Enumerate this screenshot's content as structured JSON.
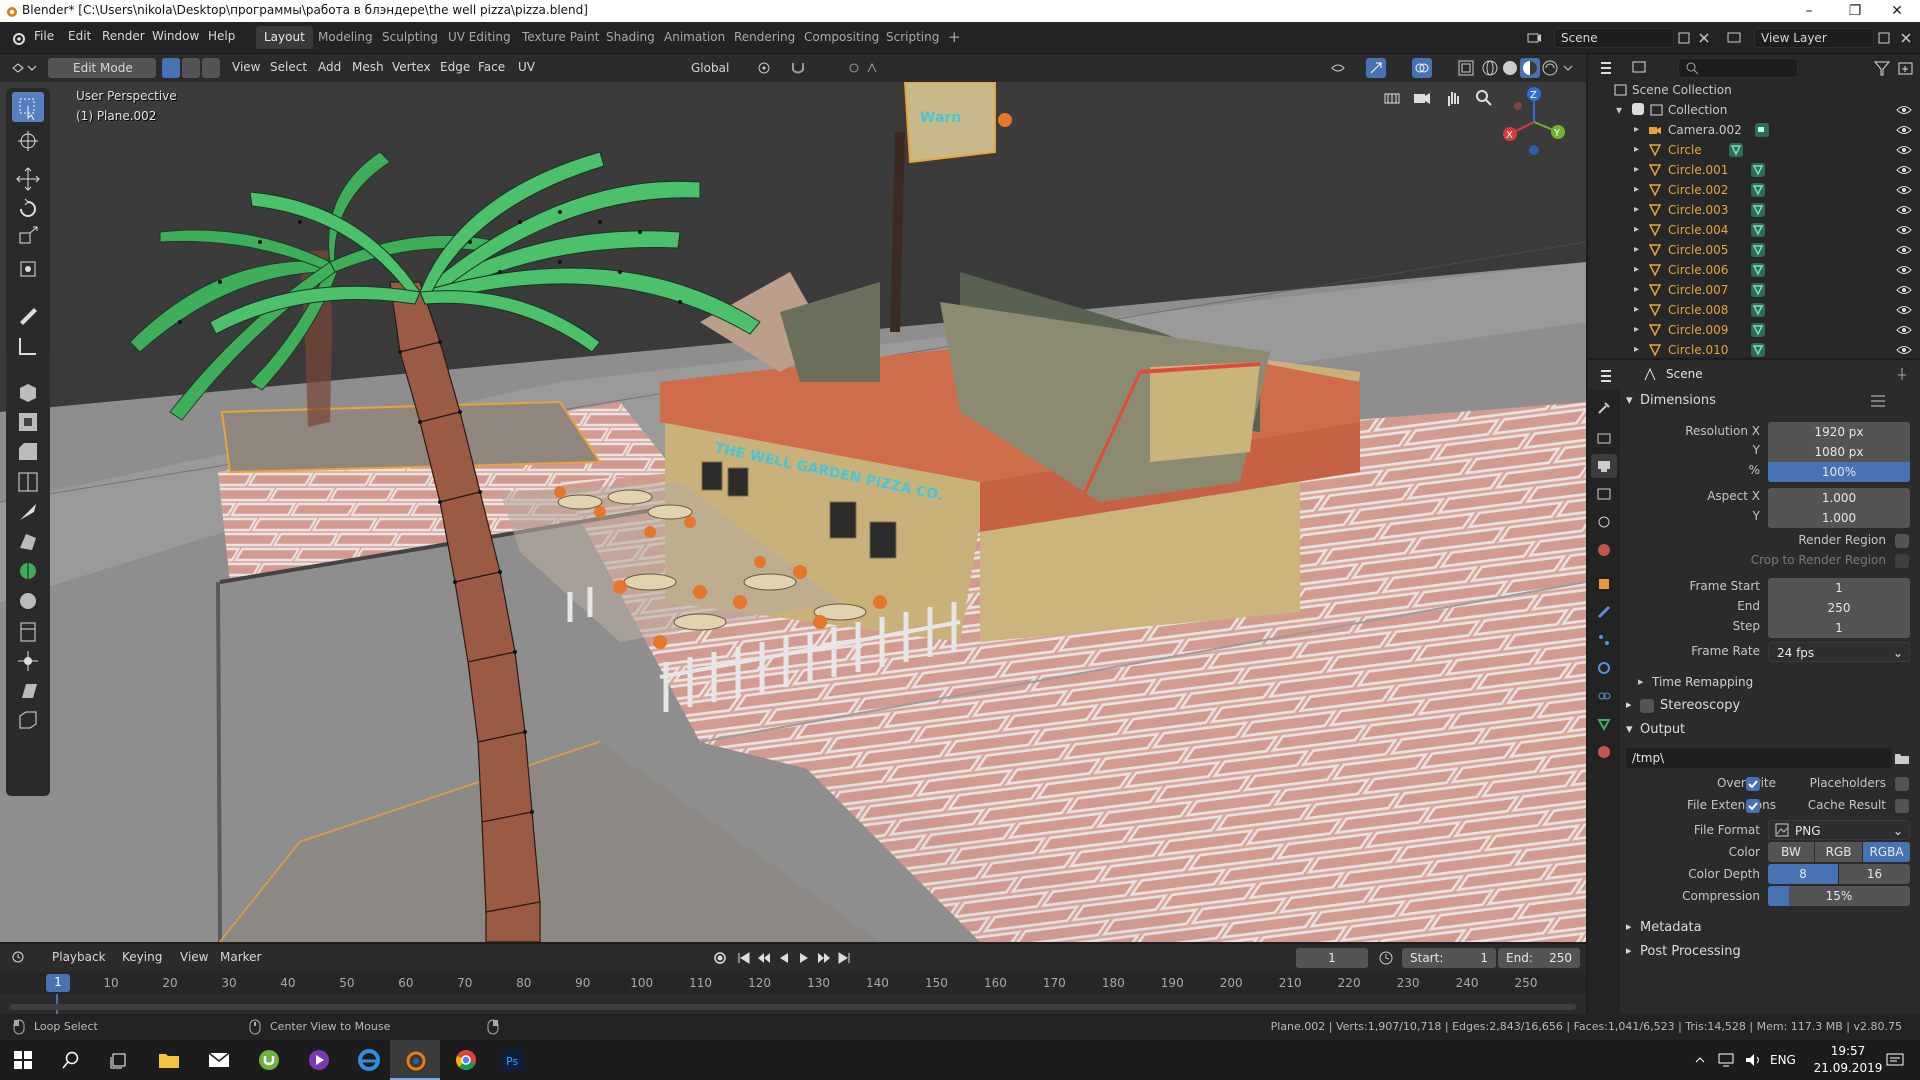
{
  "window": {
    "title": "Blender* [C:\\Users\\nikola\\Desktop\\программы\\работа в блэндере\\the well pizza\\pizza.blend]"
  },
  "menus": [
    "File",
    "Edit",
    "Render",
    "Window",
    "Help"
  ],
  "workspaces": [
    "Layout",
    "Modeling",
    "Sculpting",
    "UV Editing",
    "Texture Paint",
    "Shading",
    "Animation",
    "Rendering",
    "Compositing",
    "Scripting"
  ],
  "active_workspace": "Layout",
  "scene_field": "Scene",
  "view_layer_field": "View Layer",
  "header3d": {
    "mode": "Edit Mode",
    "menus": [
      "View",
      "Select",
      "Add",
      "Mesh",
      "Vertex",
      "Edge",
      "Face",
      "UV"
    ],
    "orientation": "Global"
  },
  "viewport": {
    "perspective": "User Perspective",
    "object": "(1) Plane.002",
    "sign_text": "Warn",
    "restaurant_sign": "THE WELL GARDEN PIZZA CO."
  },
  "outliner": {
    "root": "Scene Collection",
    "collection": "Collection",
    "items": [
      {
        "name": "Camera.002",
        "color": "#c8c8c8"
      },
      {
        "name": "Circle",
        "color": "#e8a33a"
      },
      {
        "name": "Circle.001",
        "color": "#e8a33a"
      },
      {
        "name": "Circle.002",
        "color": "#e8a33a"
      },
      {
        "name": "Circle.003",
        "color": "#e8a33a"
      },
      {
        "name": "Circle.004",
        "color": "#e8a33a"
      },
      {
        "name": "Circle.005",
        "color": "#e8a33a"
      },
      {
        "name": "Circle.006",
        "color": "#e8a33a"
      },
      {
        "name": "Circle.007",
        "color": "#e8a33a"
      },
      {
        "name": "Circle.008",
        "color": "#e8a33a"
      },
      {
        "name": "Circle.009",
        "color": "#e8a33a"
      },
      {
        "name": "Circle.010",
        "color": "#e8a33a"
      }
    ]
  },
  "properties": {
    "context": "Scene",
    "dimensions": {
      "title": "Dimensions",
      "resolution_x_label": "Resolution X",
      "resolution_x": "1920 px",
      "y_label": "Y",
      "resolution_y": "1080 px",
      "pct_label": "%",
      "pct": "100%",
      "aspect_x_label": "Aspect X",
      "aspect_x": "1.000",
      "aspect_y_label": "Y",
      "aspect_y": "1.000",
      "render_region": "Render Region",
      "crop": "Crop to Render Region",
      "frame_start_label": "Frame Start",
      "frame_start": "1",
      "end_label": "End",
      "end": "250",
      "step_label": "Step",
      "step": "1",
      "frame_rate_label": "Frame Rate",
      "frame_rate": "24 fps",
      "time_remapping": "Time Remapping"
    },
    "stereoscopy": "Stereoscopy",
    "output": {
      "title": "Output",
      "path": "/tmp\\",
      "overwrite": "Overwrite",
      "placeholders": "Placeholders",
      "file_extensions": "File Extensions",
      "cache_result": "Cache Result",
      "file_format_label": "File Format",
      "file_format": "PNG",
      "color_label": "Color",
      "color_options": [
        "BW",
        "RGB",
        "RGBA"
      ],
      "color_selected": "RGBA",
      "depth_label": "Color Depth",
      "depth_options": [
        "8",
        "16"
      ],
      "depth_selected": "8",
      "compression_label": "Compression",
      "compression": "15%",
      "compression_value": 0.15
    },
    "metadata": "Metadata",
    "post_processing": "Post Processing"
  },
  "timeline": {
    "menus": [
      "Playback",
      "Keying",
      "View",
      "Marker"
    ],
    "current_frame": "1",
    "start_label": "Start:",
    "start": "1",
    "end_label": "End:",
    "end": "250",
    "ticks": [
      "1",
      "10",
      "20",
      "30",
      "40",
      "50",
      "60",
      "70",
      "80",
      "90",
      "100",
      "110",
      "120",
      "130",
      "140",
      "150",
      "160",
      "170",
      "180",
      "190",
      "200",
      "210",
      "220",
      "230",
      "240",
      "250"
    ]
  },
  "status": {
    "left": "Loop Select",
    "middle": "Center View to Mouse",
    "right": "Plane.002 | Verts:1,907/10,718 | Edges:2,843/16,656 | Faces:1,041/6,523 | Tris:14,528 | Mem: 117.3 MB | v2.80.75"
  },
  "taskbar": {
    "lang": "ENG",
    "time": "19:57",
    "date": "21.09.2019"
  },
  "colors": {
    "accent": "#4772b3",
    "object_orange": "#e8a33a",
    "leaf_green": "#3fae5a",
    "brick": "#d7a79d"
  }
}
